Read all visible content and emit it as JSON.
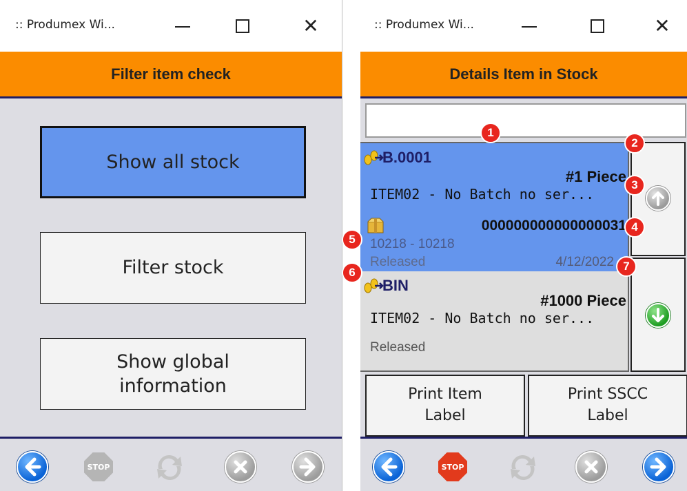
{
  "left_window": {
    "title": ":: Produmex Wi...",
    "header": "Filter item check",
    "buttons": {
      "show_all_stock": "Show all stock",
      "filter_stock": "Filter stock",
      "show_global_information": "Show global information"
    },
    "footer_icons": [
      "back-arrow-icon",
      "stop-icon",
      "refresh-icon",
      "cancel-icon",
      "forward-arrow-icon"
    ]
  },
  "right_window": {
    "title": ":: Produmex Wi...",
    "header": "Details Item in Stock",
    "search_value": "",
    "items": [
      {
        "location": "B.0001",
        "quantity": "#1 Piece",
        "description": "ITEM02 - No Batch no ser...",
        "sscc": "000000000000000031",
        "batch": "10218 - 10218",
        "status": "Released",
        "date": "4/12/2022",
        "selected": true
      },
      {
        "location": "BIN",
        "quantity": "#1000 Piece",
        "description": "ITEM02 - No Batch no ser...",
        "status": "Released",
        "selected": false
      }
    ],
    "print_item_label": "Print Item Label",
    "print_sscc_label": "Print SSCC Label",
    "footer_icons": [
      "back-arrow-icon",
      "stop-icon",
      "refresh-icon",
      "cancel-icon",
      "forward-arrow-icon"
    ]
  },
  "callouts": [
    "1",
    "2",
    "3",
    "4",
    "5",
    "6",
    "7"
  ],
  "colors": {
    "header_orange": "#fb8c00",
    "selected_blue": "#6495ed",
    "navy": "#1e1e66",
    "callout_red": "#e8261e"
  }
}
